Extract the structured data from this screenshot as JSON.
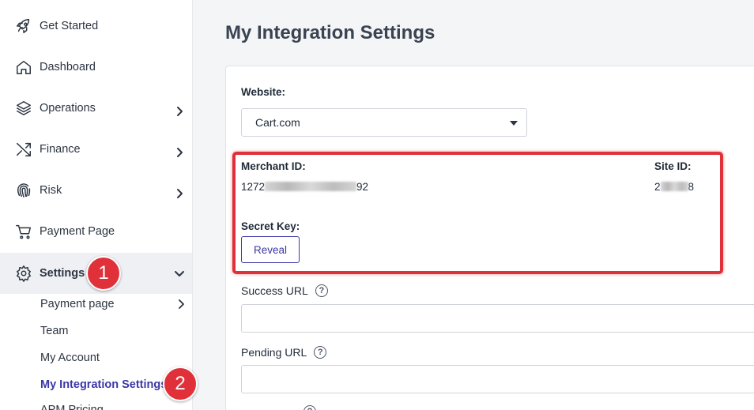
{
  "sidebar": {
    "items": [
      {
        "label": "Get Started",
        "icon": "rocket-icon"
      },
      {
        "label": "Dashboard",
        "icon": "home-icon"
      },
      {
        "label": "Operations",
        "icon": "layers-icon"
      },
      {
        "label": "Finance",
        "icon": "shuffle-icon"
      },
      {
        "label": "Risk",
        "icon": "fingerprint-icon"
      },
      {
        "label": "Payment Page",
        "icon": "cart-icon"
      },
      {
        "label": "Settings",
        "icon": "gear-icon"
      }
    ],
    "settings_subitems": [
      {
        "label": "Payment page"
      },
      {
        "label": "Team"
      },
      {
        "label": "My Account"
      },
      {
        "label": "My Integration Settings"
      },
      {
        "label": "APM Pricing"
      }
    ]
  },
  "annotations": {
    "badge_1": "1",
    "badge_2": "2",
    "badge_color": "#e0313a"
  },
  "main": {
    "title": "My Integration Settings",
    "website_label": "Website:",
    "website_value": "Cart.com",
    "merchant_id_label": "Merchant ID:",
    "merchant_id_prefix": "1272",
    "merchant_id_suffix": "92",
    "site_id_label": "Site ID:",
    "site_id_prefix": "2",
    "site_id_suffix": "8",
    "secret_key_label": "Secret Key:",
    "reveal_button": "Reveal",
    "success_url_label": "Success URL",
    "success_url_value": "",
    "pending_url_label": "Pending URL",
    "pending_url_value": "",
    "help_glyph": "?"
  },
  "colors": {
    "accent": "#3b37a6",
    "highlight_border": "#e0313a"
  }
}
